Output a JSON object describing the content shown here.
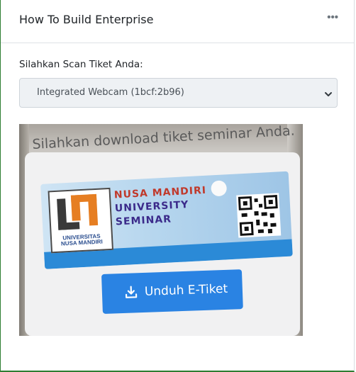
{
  "card": {
    "title": "How To Build Enterprise",
    "menu_icon": "more-horizontal-icon",
    "menu_glyph": "•••"
  },
  "form": {
    "label": "Silahkan Scan Tiket Anda:",
    "camera_select": {
      "selected": "Integrated Webcam (1bcf:2b96)",
      "icon": "chevron-down-icon"
    }
  },
  "camera_feed": {
    "screen_heading": "Silahkan download tiket seminar Anda.",
    "banner": {
      "title_line1": "NUSA MANDIRI",
      "title_line2": "UNIVERSITY",
      "title_line3": "SEMINAR",
      "logo_text_line1": "UNIVERSITAS",
      "logo_text_line2": "NUSA MANDIRI"
    },
    "download_button": {
      "label": "Unduh E-Tiket",
      "icon": "download-icon"
    }
  },
  "colors": {
    "accent_border": "#2e7d32",
    "button": "#2a83e3",
    "banner_red": "#c0392b",
    "banner_purple": "#3b2a8a"
  }
}
